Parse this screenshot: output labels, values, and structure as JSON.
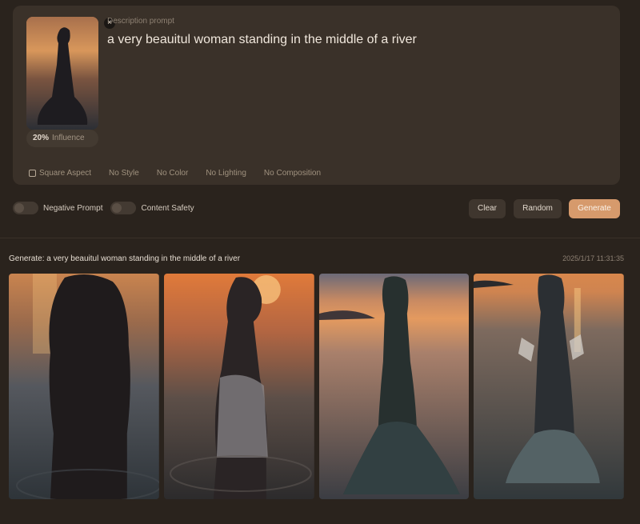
{
  "prompt_panel": {
    "desc_label": "Description prompt",
    "desc_text": "a very beauitul woman standing in the middle of a river",
    "close_glyph": "×",
    "influence": {
      "percent": "20%",
      "label": "Influence"
    },
    "options": [
      "Square Aspect",
      "No Style",
      "No Color",
      "No Lighting",
      "No Composition"
    ]
  },
  "toggles": [
    {
      "label": "Negative Prompt",
      "on": false
    },
    {
      "label": "Content Safety",
      "on": false
    }
  ],
  "buttons": {
    "clear": "Clear",
    "random": "Random",
    "generate": "Generate"
  },
  "results": {
    "title": "Generate: a very beauitul woman standing in the middle of a river",
    "timestamp": "2025/1/17 11:31:35",
    "images": [
      "generated-image-1",
      "generated-image-2",
      "generated-image-3",
      "generated-image-4"
    ]
  },
  "colors": {
    "accent": "#d69a6c",
    "panel": "#3a3129",
    "background": "#2a231d"
  }
}
